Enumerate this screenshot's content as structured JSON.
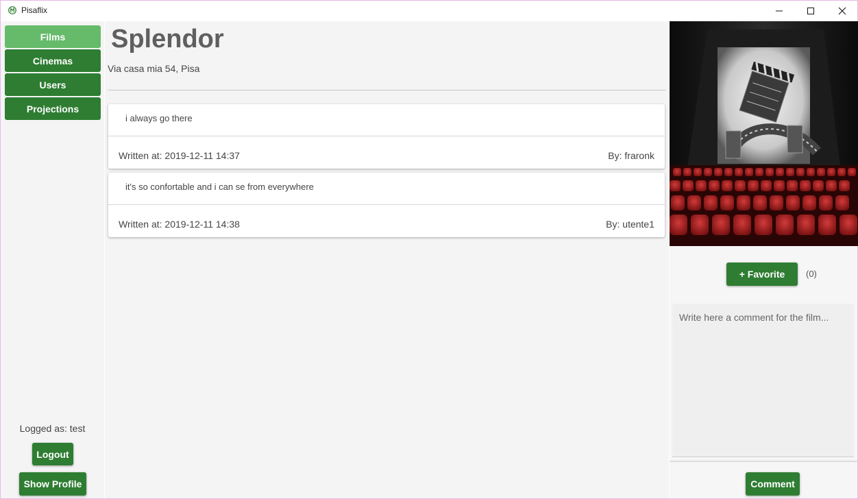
{
  "window": {
    "title": "Pisaflix",
    "controls": {
      "minimize_icon": "minimize-icon",
      "maximize_icon": "maximize-icon",
      "close_icon": "close-icon"
    }
  },
  "sidebar": {
    "items": [
      {
        "label": "Films",
        "active": true
      },
      {
        "label": "Cinemas",
        "active": false
      },
      {
        "label": "Users",
        "active": false
      },
      {
        "label": "Projections",
        "active": false
      }
    ],
    "logged_as": "Logged as: test",
    "logout_label": "Logout",
    "show_profile_label": "Show Profile"
  },
  "cinema": {
    "name": "Splendor",
    "address": "Via casa mia 54, Pisa"
  },
  "comments": [
    {
      "text": "i always go there",
      "written_at": "Written at: 2019-12-11 14:37",
      "author": "By: fraronk"
    },
    {
      "text": "it's so confortable and i can se from everywhere",
      "written_at": "Written at: 2019-12-11 14:38",
      "author": "By: utente1"
    }
  ],
  "panel": {
    "poster_icon": "cinema-poster-image",
    "favorite_label": "+ Favorite",
    "favorite_count": "(0)",
    "comment_placeholder": "Write here a comment for the film...",
    "comment_label": "Comment"
  },
  "colors": {
    "primary_green": "#2e7d32",
    "active_green": "#66bb6a",
    "background": "#f4f4f4"
  }
}
